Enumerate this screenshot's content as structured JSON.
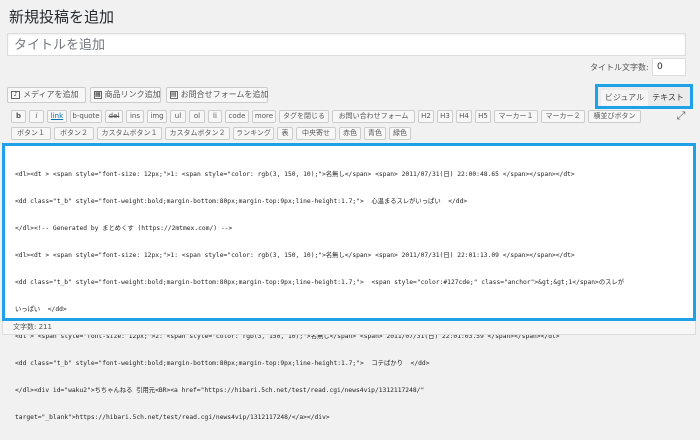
{
  "page": {
    "title": "新規投稿を追加"
  },
  "title_input": {
    "placeholder": "タイトルを追加"
  },
  "title_count": {
    "label": "タイトル文字数:",
    "value": "0"
  },
  "media_buttons": [
    {
      "label": "メディアを追加",
      "icon": "media-icon"
    },
    {
      "label": "商品リンク追加",
      "icon": "product-link-icon"
    },
    {
      "label": "お問合せフォームを追加",
      "icon": "form-icon"
    }
  ],
  "editor_tabs": {
    "visual": "ビジュアル",
    "text": "テキスト",
    "accent": "#1ea1e6"
  },
  "quicktags_row1": [
    "b",
    "i",
    "link",
    "b-quote",
    "del",
    "ins",
    "img",
    "ul",
    "ol",
    "li",
    "code",
    "more",
    "タグを閉じる",
    "お問い合わせフォーム",
    "H2",
    "H3",
    "H4",
    "H5",
    "マーカー１",
    "マーカー２",
    "横並びボタン"
  ],
  "quicktags_row2": [
    "ボタン１",
    "ボタン２",
    "カスタムボタン１",
    "カスタムボタン２",
    "ランキング",
    "表",
    "中央寄せ",
    "赤色",
    "青色",
    "緑色"
  ],
  "code_lines": [
    "<dl><dt > <span style=\"font-size: 12px;\">1: <span style=\"color: rgb(3, 150, 10);\">名無し</span> <span> 2011/07/31(日) 22:00:48.65 </span></span></dt>",
    "<dd class=\"t_b\" style=\"font-weight:bold;margin-bottom:80px;margin-top:9px;line-height:1.7;\">  心温まるスレがいっぱい  </dd>",
    "</dl><!-- Generated by まとめくす (https://2mtmex.com/) -->",
    "<dl><dt > <span style=\"font-size: 12px;\">1: <span style=\"color: rgb(3, 150, 10);\">名無し</span> <span> 2011/07/31(日) 22:01:13.09 </span></span></dt>",
    "<dd class=\"t_b\" style=\"font-weight:bold;margin-bottom:80px;margin-top:9px;line-height:1.7;\">  <span style=\"color:#127cde;\" class=\"anchor\">&gt;&gt;1</span>のスレが",
    "いっぱい  </dd>",
    "<dt > <span style=\"font-size: 12px;\">2: <span style=\"color: rgb(3, 150, 10);\">名無し</span> <span> 2011/07/31(日) 22:01:03.59 </span></span></dt>",
    "<dd class=\"t_b\" style=\"font-weight:bold;margin-bottom:80px;margin-top:9px;line-height:1.7;\">  コテばかり  </dd>",
    "</dl><div id=\"waku2\">ちちゃんねる 引用元<BR><a href=\"https://hibari.5ch.net/test/read.cgi/news4vip/1312117248/\"",
    "target=\"_blank\">https://hibari.5ch.net/test/read.cgi/news4vip/1312117248/</a></div>"
  ],
  "status_bar": {
    "word_count": "文字数: 211"
  }
}
